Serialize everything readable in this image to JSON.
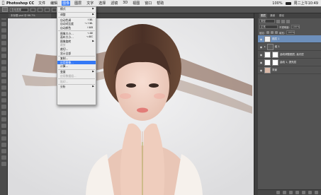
{
  "menubar": {
    "app": "Photoshop CC",
    "items": [
      "文件",
      "编辑",
      "图像",
      "图层",
      "文字",
      "选择",
      "滤镜",
      "3D",
      "视图",
      "窗口",
      "帮助"
    ],
    "active_index": 2,
    "battery": "100%",
    "clock": "周二上午10:49"
  },
  "optbar": {
    "tool_label": "自动选择"
  },
  "document": {
    "tab_title": "未标题.psd @ 66.7%"
  },
  "image_menu": [
    {
      "label": "模式",
      "arrow": true
    },
    {
      "sep": true
    },
    {
      "label": "调整",
      "arrow": true
    },
    {
      "sep": true
    },
    {
      "label": "自动色调",
      "shortcut": "⇧⌘L"
    },
    {
      "label": "自动对比度",
      "shortcut": "⌥⇧⌘L"
    },
    {
      "label": "自动颜色",
      "shortcut": "⇧⌘B"
    },
    {
      "sep": true
    },
    {
      "label": "图像大小...",
      "shortcut": "⌥⌘I"
    },
    {
      "label": "画布大小...",
      "shortcut": "⌥⌘C"
    },
    {
      "label": "图像旋转",
      "arrow": true
    },
    {
      "label": "裁剪",
      "disabled": true
    },
    {
      "label": "裁切..."
    },
    {
      "label": "显示全部"
    },
    {
      "sep": true
    },
    {
      "label": "复制..."
    },
    {
      "label": "应用图像...",
      "highlighted": true
    },
    {
      "label": "计算..."
    },
    {
      "sep": true
    },
    {
      "label": "变量",
      "arrow": true
    },
    {
      "label": "应用数据组...",
      "disabled": true
    },
    {
      "sep": true
    },
    {
      "label": "陷印...",
      "disabled": true
    },
    {
      "sep": true
    },
    {
      "label": "分析",
      "arrow": true
    }
  ],
  "layers_panel": {
    "tabs": [
      "图层",
      "通道",
      "路径"
    ],
    "kind_filter": "类型",
    "blend_mode": "正常",
    "opacity_label": "不透明度:",
    "opacity": "100%",
    "lock_label": "锁定:",
    "fill_label": "填充:",
    "fill": "100%",
    "layers": [
      {
        "name": "图层 1",
        "selected": true,
        "mask": false
      },
      {
        "name": "组 1",
        "selected": false,
        "mask": false,
        "group": true
      },
      {
        "name": "曲线调整图层, 高光层",
        "selected": false,
        "mask": true
      },
      {
        "name": "曲线 1, 提亮层",
        "selected": false,
        "mask": true
      },
      {
        "name": "背景",
        "selected": false,
        "mask": false
      }
    ]
  }
}
